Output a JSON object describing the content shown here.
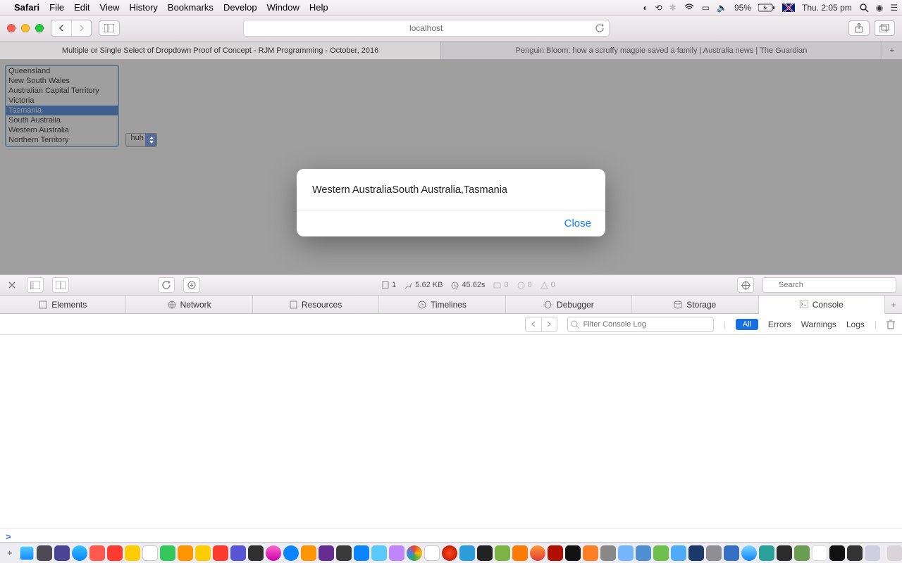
{
  "menubar": {
    "app": "Safari",
    "items": [
      "File",
      "Edit",
      "View",
      "History",
      "Bookmarks",
      "Develop",
      "Window",
      "Help"
    ],
    "battery": "95%",
    "clock": "Thu. 2:05 pm"
  },
  "toolbar": {
    "url": "localhost"
  },
  "tabs": {
    "active": "Multiple or Single Select of Dropdown Proof of Concept - RJM Programming - October, 2016",
    "inactive": "Penguin Bloom: how a scruffy magpie saved a family | Australia news | The Guardian"
  },
  "listbox": {
    "options": [
      "Queensland",
      "New South Wales",
      "Australian Capital Territory",
      "Victoria",
      "Tasmania",
      "South Australia",
      "Western Australia",
      "Northern Territory"
    ],
    "selected": "Tasmania"
  },
  "dropdown": {
    "value": "huh"
  },
  "alert": {
    "message": "Western AustraliaSouth Australia,Tasmania",
    "close": "Close"
  },
  "devtools": {
    "stats": {
      "docs": "1",
      "size": "5.62 KB",
      "time": "45.62s",
      "log0a": "0",
      "log0b": "0",
      "warn0": "0"
    },
    "search_placeholder": "Search",
    "tabs": [
      "Elements",
      "Network",
      "Resources",
      "Timelines",
      "Debugger",
      "Storage",
      "Console"
    ],
    "filter_placeholder": "Filter Console Log",
    "all": "All",
    "errors": "Errors",
    "warnings": "Warnings",
    "logs": "Logs"
  }
}
